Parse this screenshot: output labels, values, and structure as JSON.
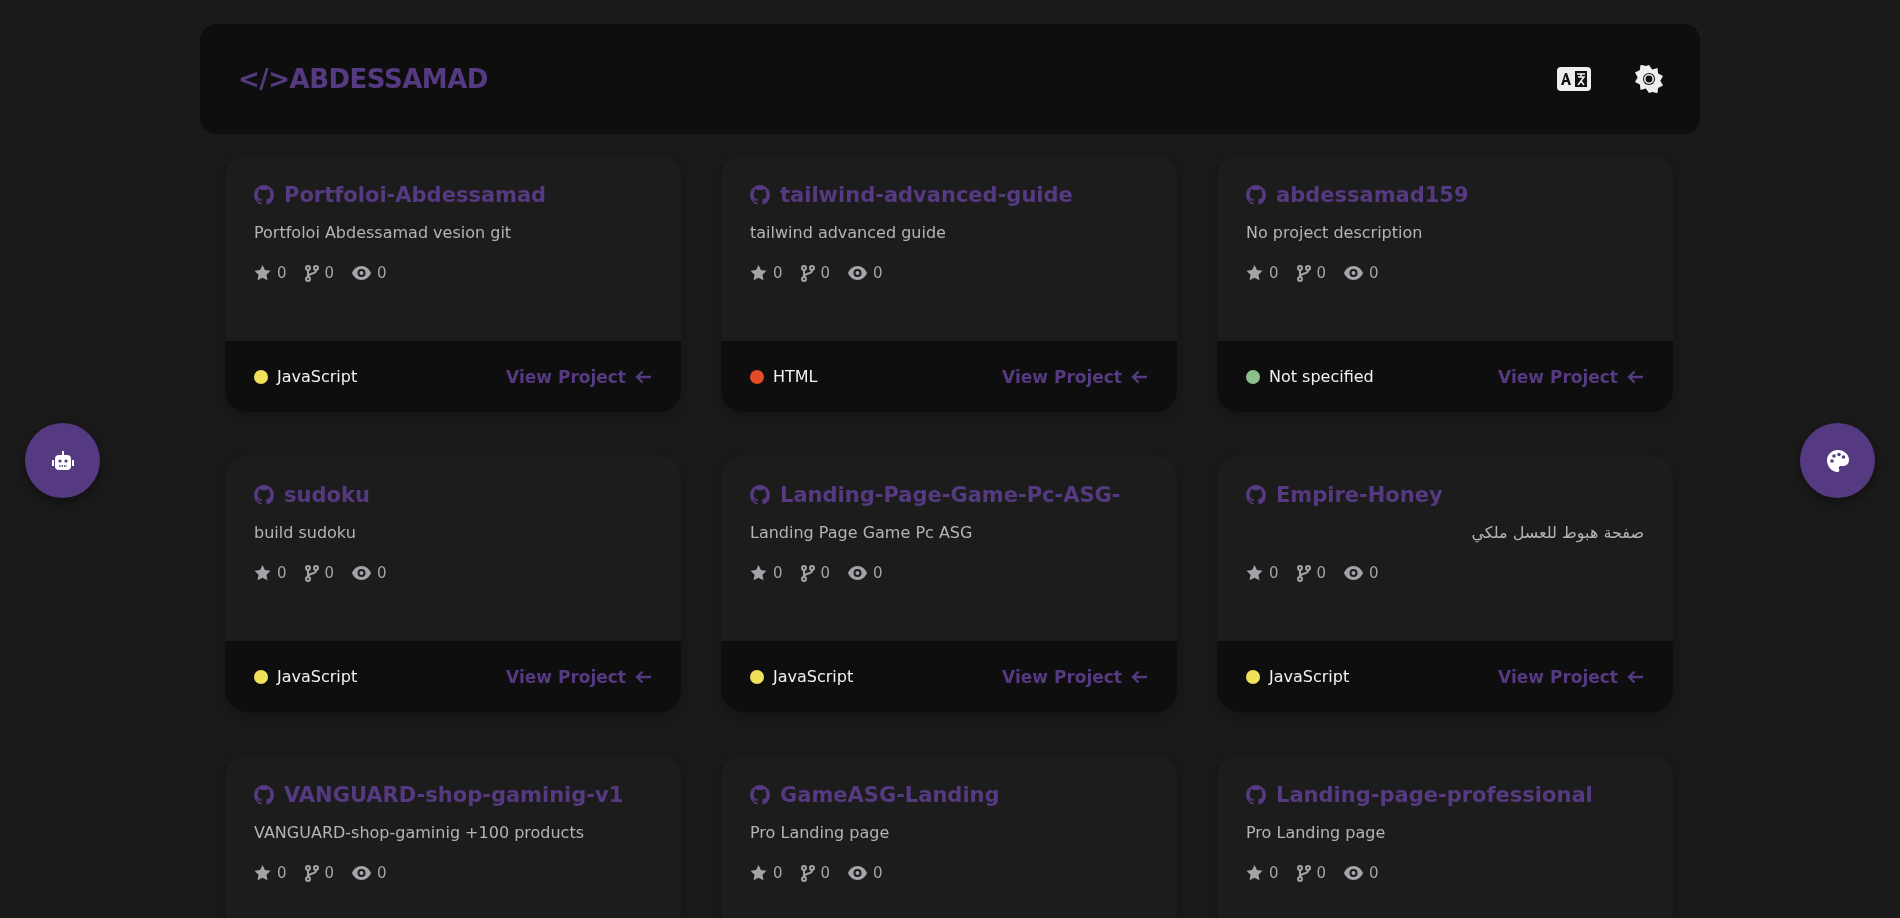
{
  "header": {
    "logo": "</>ABDESSAMAD"
  },
  "projects": [
    {
      "name": "Portfoloi-Abdessamad",
      "description": "Portfoloi Abdessamad vesion git",
      "stars": "0",
      "forks": "0",
      "watchers": "0",
      "language": "JavaScript",
      "color": "#f1e05a",
      "link": "View Project"
    },
    {
      "name": "tailwind-advanced-guide",
      "description": "tailwind advanced guide",
      "stars": "0",
      "forks": "0",
      "watchers": "0",
      "language": "HTML",
      "color": "#e34c26",
      "link": "View Project"
    },
    {
      "name": "abdessamad159",
      "description": "No project description",
      "stars": "0",
      "forks": "0",
      "watchers": "0",
      "language": "Not specified",
      "color": "#8bc08b",
      "link": "View Project"
    },
    {
      "name": "sudoku",
      "description": "build sudoku",
      "stars": "0",
      "forks": "0",
      "watchers": "0",
      "language": "JavaScript",
      "color": "#f1e05a",
      "link": "View Project"
    },
    {
      "name": "Landing-Page-Game-Pc-ASG-",
      "description": "Landing Page Game Pc ASG",
      "stars": "0",
      "forks": "0",
      "watchers": "0",
      "language": "JavaScript",
      "color": "#f1e05a",
      "link": "View Project"
    },
    {
      "name": "Empire-Honey",
      "description": "صفحة هبوط للعسل ملكي",
      "stars": "0",
      "forks": "0",
      "watchers": "0",
      "language": "JavaScript",
      "color": "#f1e05a",
      "link": "View Project"
    },
    {
      "name": "VANGUARD-shop-gaminig-v1",
      "description": "VANGUARD-shop-gaminig +100 products",
      "stars": "0",
      "forks": "0",
      "watchers": "0"
    },
    {
      "name": "GameASG-Landing",
      "description": "Pro Landing page",
      "stars": "0",
      "forks": "0",
      "watchers": "0"
    },
    {
      "name": "Landing-page-professional",
      "description": "Pro Landing page",
      "stars": "0",
      "forks": "0",
      "watchers": "0"
    }
  ]
}
